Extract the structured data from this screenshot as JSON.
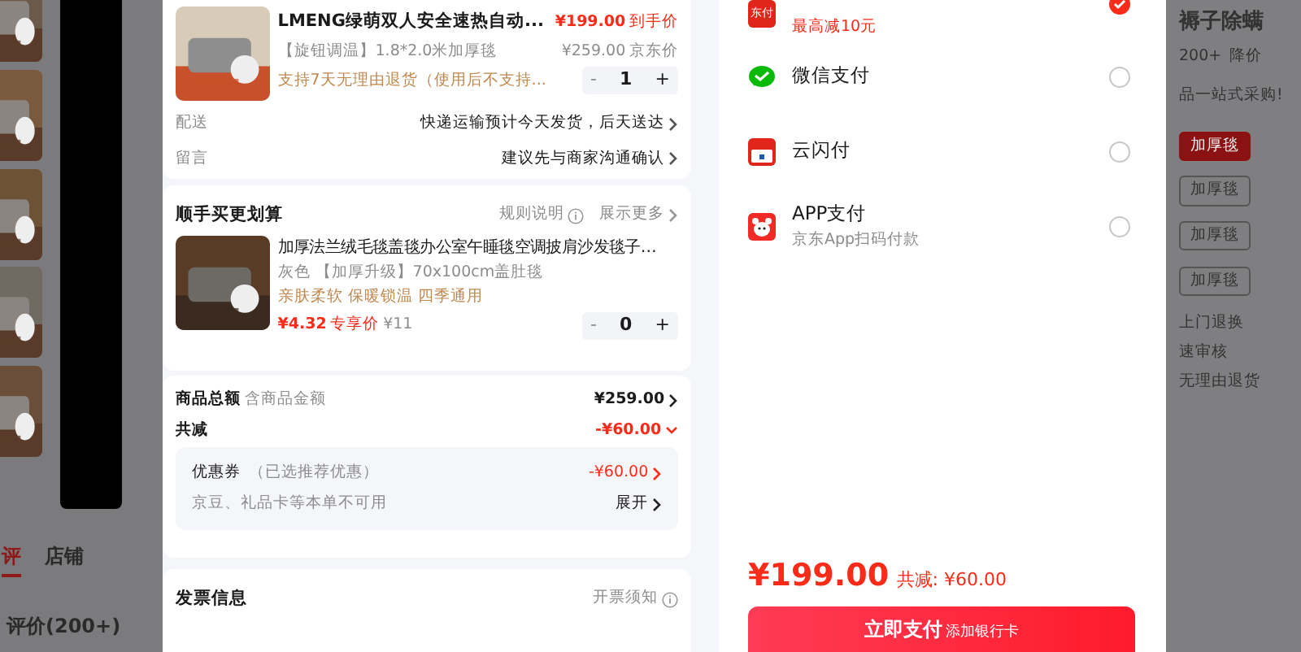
{
  "background_page": {
    "tabs": [
      {
        "label": "评",
        "selected": true
      },
      {
        "label": "店铺",
        "selected": false
      }
    ],
    "reviews_heading": "评价(200+)",
    "title": "褥子除螨",
    "count": "200+",
    "price_tag": "降价",
    "promo": "品一站式采购!",
    "options": [
      {
        "label": "加厚毯",
        "selected": true
      },
      {
        "label": "加厚毯",
        "selected": false
      },
      {
        "label": "加厚毯",
        "selected": false
      },
      {
        "label": "加厚毯",
        "selected": false
      }
    ],
    "services": [
      "上门退换",
      "速审核",
      "无理由退货"
    ]
  },
  "order": {
    "product": {
      "title": "LMENG绿萌双人安全速热自动...",
      "spec": "【旋钮调温】1.8*2.0米加厚毯",
      "support": "支持7天无理由退货（使用后不支持...",
      "price": "¥199.00",
      "price_label": "到手价",
      "original_price": "¥259.00",
      "original_label": "京东价",
      "minus": "-",
      "quantity": "1",
      "plus": "+"
    },
    "rows": [
      {
        "label": "配送",
        "value": "快递运输预计今天发货，后天送达"
      },
      {
        "label": "留言",
        "value": "建议先与商家沟通确认"
      }
    ]
  },
  "addon": {
    "title": "顺手买更划算",
    "rules": "规则说明",
    "more": "展示更多",
    "item": {
      "title": "加厚法兰绒毛毯盖毯办公室午睡毯空调披肩沙发毯子…",
      "spec": "灰色 【加厚升级】70x100cm盖肚毯",
      "tags": "亲肤柔软 保暖锁温 四季通用",
      "price": "¥4.32",
      "price_label": "专享价",
      "original_price": "¥11",
      "minus": "-",
      "quantity": "0",
      "plus": "+"
    }
  },
  "summary": {
    "total_label": "商品总额",
    "total_note": "含商品金额",
    "total": "¥259.00",
    "discount_label": "共减",
    "discount": "-¥60.00",
    "coupon_label": "优惠券",
    "coupon_note": "（已选推荐优惠）",
    "coupon_value": "-¥60.00",
    "beans_note": "京豆、礼品卡等本单不可用",
    "expand": "展开"
  },
  "invoice": {
    "title": "发票信息",
    "note": "开票须知"
  },
  "payment": {
    "methods": [
      {
        "kind": "jdpay",
        "icon_text": "东付",
        "subtitle": "最高减10元",
        "selected": true
      },
      {
        "kind": "wechat",
        "name": "微信支付",
        "selected": false
      },
      {
        "kind": "unionpay",
        "name": "云闪付",
        "selected": false
      },
      {
        "kind": "jdapp",
        "name": "APP支付",
        "subtitle": "京东App扫码付款",
        "selected": false
      }
    ],
    "amount": "¥199.00",
    "discount": "共减: ¥60.00",
    "pay_button": {
      "label": "立即支付",
      "note": "添加银行卡"
    }
  }
}
